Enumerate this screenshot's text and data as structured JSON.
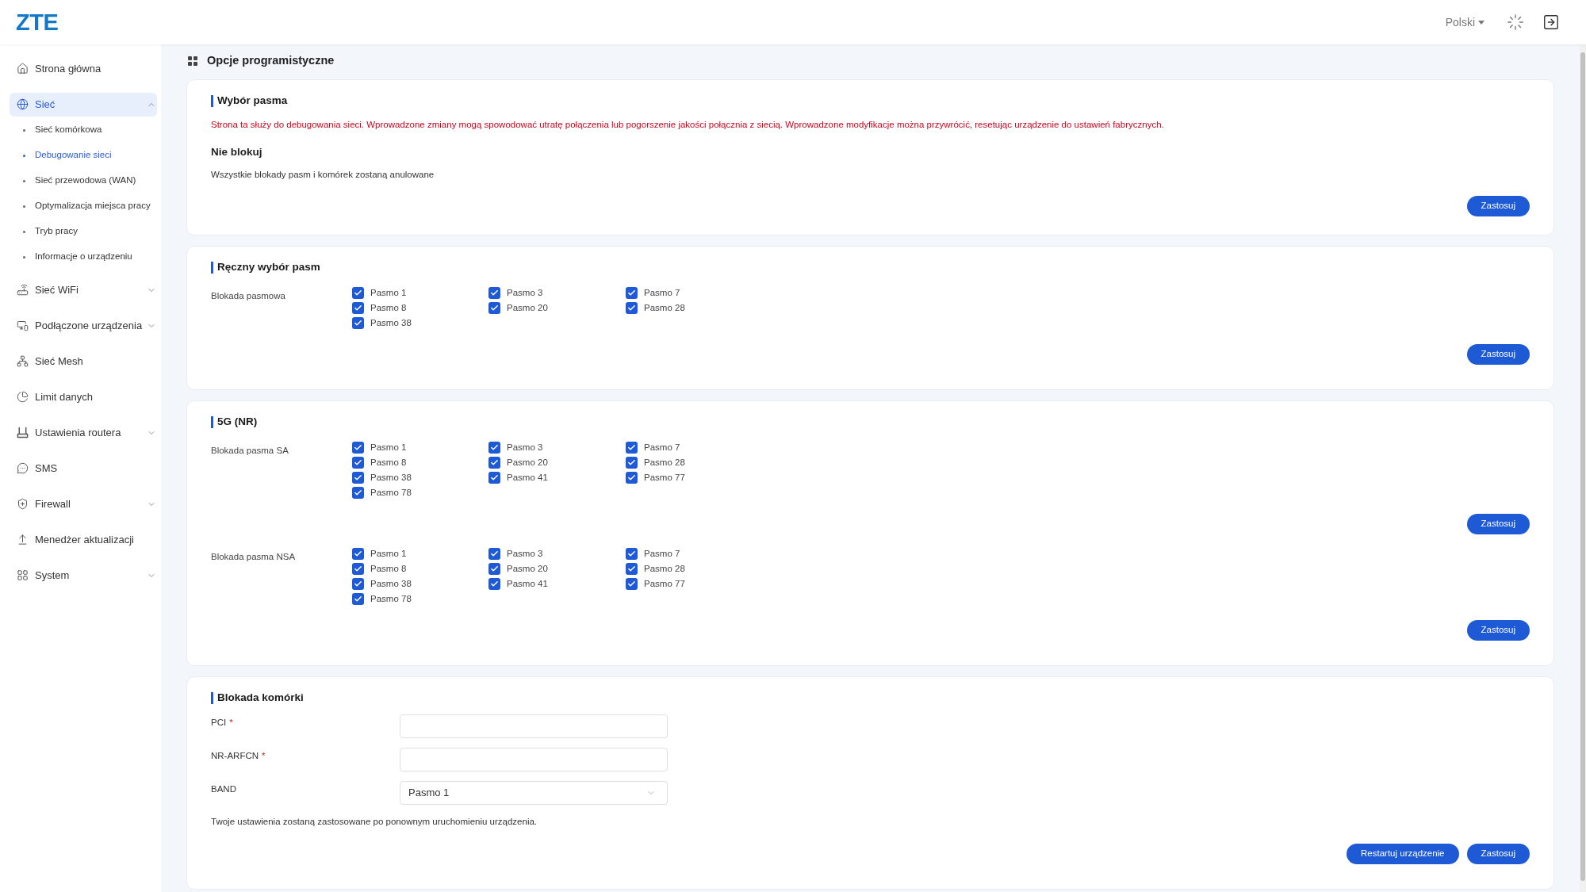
{
  "header": {
    "logo": "ZTE",
    "language": "Polski"
  },
  "sidebar": {
    "items": [
      {
        "label": "Strona główna",
        "selected": false
      },
      {
        "label": "Sieć",
        "selected": true,
        "expanded": true,
        "children": [
          {
            "label": "Sieć komórkowa",
            "selected": false
          },
          {
            "label": "Debugowanie sieci",
            "selected": true
          },
          {
            "label": "Sieć przewodowa (WAN)",
            "selected": false
          },
          {
            "label": "Optymalizacja miejsca pracy",
            "selected": false
          },
          {
            "label": "Tryb pracy",
            "selected": false
          },
          {
            "label": "Informacje o urządzeniu",
            "selected": false
          }
        ]
      },
      {
        "label": "Sieć WiFi",
        "selected": false,
        "expanded": false
      },
      {
        "label": "Podłączone urządzenia",
        "selected": false,
        "expanded": false
      },
      {
        "label": "Sieć Mesh",
        "selected": false
      },
      {
        "label": "Limit danych",
        "selected": false
      },
      {
        "label": "Ustawienia routera",
        "selected": false,
        "expanded": false
      },
      {
        "label": "SMS",
        "selected": false
      },
      {
        "label": "Firewall",
        "selected": false,
        "expanded": false
      },
      {
        "label": "Menedżer aktualizacji",
        "selected": false
      },
      {
        "label": "System",
        "selected": false,
        "expanded": false
      }
    ]
  },
  "page_title": "Opcje programistyczne",
  "band_selection": {
    "title": "Wybór pasma",
    "warning": "Strona ta służy do debugowania sieci. Wprowadzone zmiany mogą spowodować utratę połączenia lub pogorszenie jakości połącznia z siecią. Wprowadzone modyfikacje można przywrócić, resetując urządzenie do ustawień fabrycznych.",
    "option_title": "Nie blokuj",
    "option_description": "Wszystkie blokady pasm i komórek zostaną anulowane",
    "button": "Zastosuj"
  },
  "manual_band_selection": {
    "title": "Ręczny wybór pasm",
    "groups": [
      {
        "label": "Blokada pasmowa",
        "bands": [
          {
            "label": "Pasmo 1",
            "checked": true
          },
          {
            "label": "Pasmo 3",
            "checked": true
          },
          {
            "label": "Pasmo 7",
            "checked": true
          },
          {
            "label": "Pasmo 8",
            "checked": true
          },
          {
            "label": "Pasmo 20",
            "checked": true
          },
          {
            "label": "Pasmo 28",
            "checked": true
          },
          {
            "label": "Pasmo 38",
            "checked": true
          }
        ],
        "button": "Zastosuj"
      }
    ]
  },
  "nr_5g": {
    "title": "5G (NR)",
    "groups": [
      {
        "label": "Blokada pasma SA",
        "bands": [
          {
            "label": "Pasmo 1",
            "checked": true
          },
          {
            "label": "Pasmo 3",
            "checked": true
          },
          {
            "label": "Pasmo 7",
            "checked": true
          },
          {
            "label": "Pasmo 8",
            "checked": true
          },
          {
            "label": "Pasmo 20",
            "checked": true
          },
          {
            "label": "Pasmo 28",
            "checked": true
          },
          {
            "label": "Pasmo 38",
            "checked": true
          },
          {
            "label": "Pasmo 41",
            "checked": true
          },
          {
            "label": "Pasmo 77",
            "checked": true
          },
          {
            "label": "Pasmo 78",
            "checked": true
          }
        ],
        "button": "Zastosuj"
      },
      {
        "label": "Blokada pasma NSA",
        "bands": [
          {
            "label": "Pasmo 1",
            "checked": true
          },
          {
            "label": "Pasmo 3",
            "checked": true
          },
          {
            "label": "Pasmo 7",
            "checked": true
          },
          {
            "label": "Pasmo 8",
            "checked": true
          },
          {
            "label": "Pasmo 20",
            "checked": true
          },
          {
            "label": "Pasmo 28",
            "checked": true
          },
          {
            "label": "Pasmo 38",
            "checked": true
          },
          {
            "label": "Pasmo 41",
            "checked": true
          },
          {
            "label": "Pasmo 77",
            "checked": true
          },
          {
            "label": "Pasmo 78",
            "checked": true
          }
        ],
        "button": "Zastosuj"
      }
    ]
  },
  "cell_lock": {
    "title": "Blokada komórki",
    "fields": [
      {
        "label": "PCI",
        "required_mark": "*",
        "kind": "text"
      },
      {
        "label": "NR-ARFCN",
        "required_mark": "*",
        "kind": "text"
      },
      {
        "label": "BAND",
        "kind": "select",
        "value": "Pasmo 1"
      }
    ],
    "note": "Twoje ustawienia zostaną zastosowane po ponownym uruchomieniu urządzenia.",
    "buttons": [
      "Restartuj urządzenie",
      "Zastosuj"
    ]
  }
}
